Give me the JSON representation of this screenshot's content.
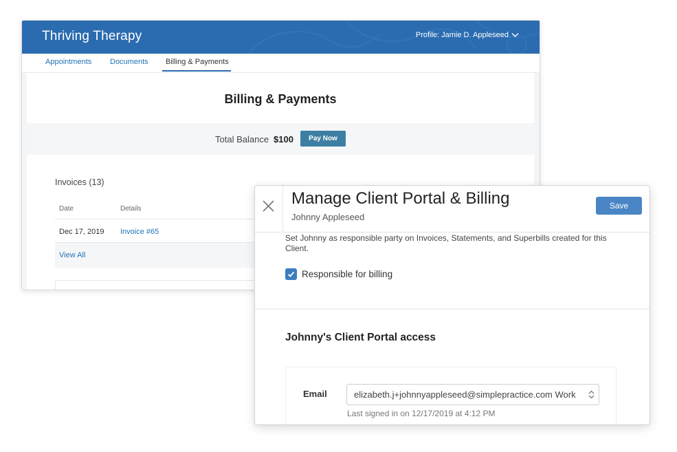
{
  "portal": {
    "brand": "Thriving Therapy",
    "profile_label": "Profile: Jamie D. Appleseed",
    "profile_icon": "chevron-down-icon",
    "tabs": [
      "Appointments",
      "Documents",
      "Billing & Payments"
    ],
    "active_tab": "Billing & Payments",
    "section_title": "Billing & Payments",
    "balance_label": "Total Balance",
    "balance_amount": "$100",
    "pay_button": "Pay Now",
    "invoices_title": "Invoices (13)",
    "table_headers": [
      "Date",
      "Details"
    ],
    "invoices": [
      {
        "date": "Dec 17, 2019",
        "details": "Invoice #65"
      }
    ],
    "view_all": "View All",
    "colors": {
      "header": "#2b6cb0",
      "link": "#2373b6",
      "pay_button": "#3d7fa3"
    }
  },
  "modal": {
    "title": "Manage Client Portal & Billing",
    "subtitle": "Johnny Appleseed",
    "close_icon": "close-icon",
    "save_button": "Save",
    "description": "Set Johnny as responsible party on Invoices, Statements, and Superbills created for this Client.",
    "checkbox_label": "Responsible for billing",
    "checkbox_checked": true,
    "access_title": "Johnny's Client Portal access",
    "email_label": "Email",
    "email_value": "elizabeth.j+johnnyappleseed@simplepractice.com Work",
    "last_signed": "Last signed in on 12/17/2019 at 4:12 PM",
    "colors": {
      "save_button": "#4a86c5",
      "checkbox": "#3b7dbf"
    }
  }
}
